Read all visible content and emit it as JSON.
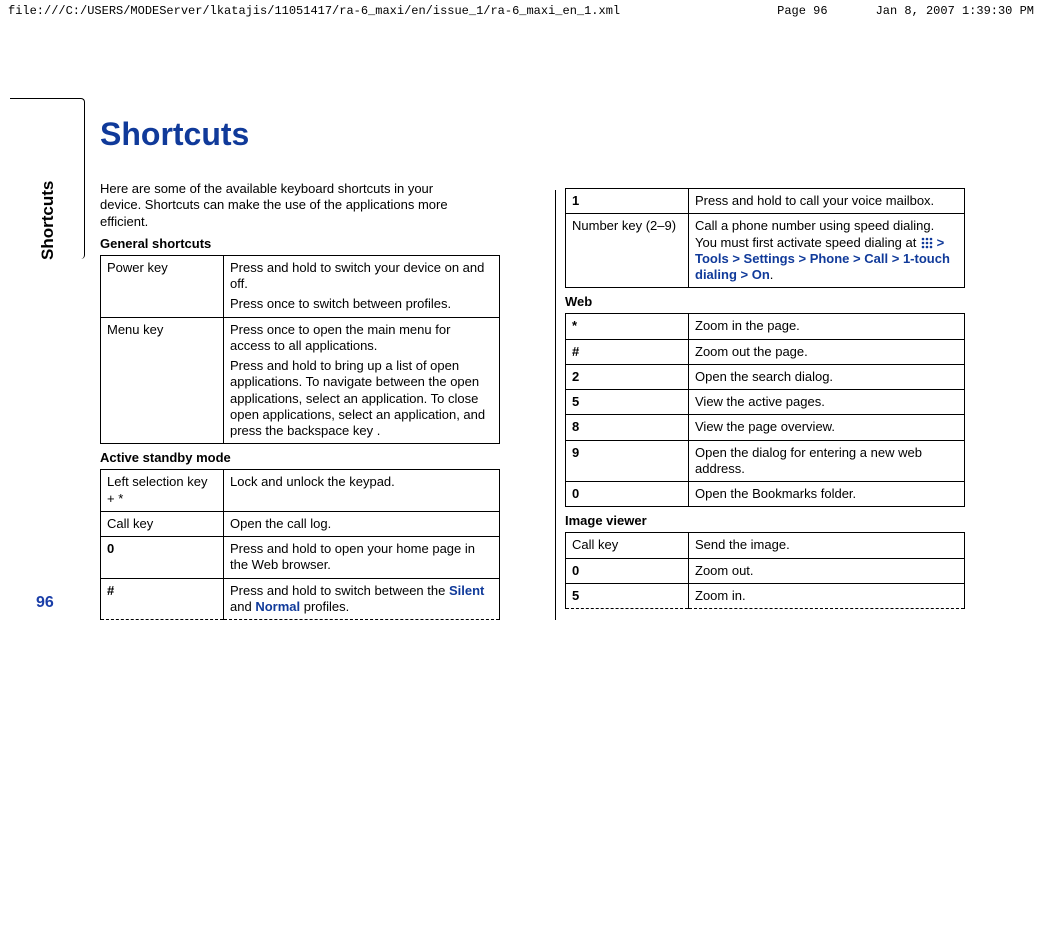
{
  "header": {
    "path": "file:///C:/USERS/MODEServer/lkatajis/11051417/ra-6_maxi/en/issue_1/ra-6_maxi_en_1.xml",
    "pageLabel": "Page 96",
    "date": "Jan 8, 2007 1:39:30 PM"
  },
  "sideTab": "Shortcuts",
  "pageNumber": "96",
  "title": "Shortcuts",
  "intro": "Here are some of the available keyboard shortcuts in your device. Shortcuts can make the use of the applications more efficient.",
  "sections": {
    "general": {
      "label": "General shortcuts",
      "rows": [
        {
          "key": "Power key",
          "desc1": "Press and hold to switch your device on and off.",
          "desc2": "Press once to switch between profiles."
        },
        {
          "key": "Menu key",
          "desc1": "Press once to open the main menu for access to all applications.",
          "desc2": "Press and hold to bring up a list of open applications. To navigate between the open applications, select an application. To close open applications, select an application, and press the backspace key ."
        }
      ]
    },
    "standby": {
      "label": "Active standby mode",
      "rows": [
        {
          "key": "Left selection key + *",
          "desc": "Lock and unlock the keypad."
        },
        {
          "key": "Call key",
          "desc": "Open the call log."
        },
        {
          "key": "0",
          "desc": "Press and hold to open your home page in the Web browser."
        },
        {
          "key": "#",
          "desc_pre": "Press and hold to switch between the ",
          "link1": "Silent",
          "mid": " and ",
          "link2": "Normal",
          "desc_post": " profiles."
        },
        {
          "key": "1",
          "desc": "Press and hold to call your voice mailbox."
        },
        {
          "key": "Number key (2–9)",
          "desc_pre": "Call a phone number using speed dialing. You must first activate speed dialing at ",
          "nav": [
            "Tools",
            "Settings",
            "Phone",
            "Call",
            "1-touch dialing",
            "On"
          ],
          "desc_post": "."
        }
      ]
    },
    "web": {
      "label": "Web",
      "rows": [
        {
          "key": "*",
          "desc": "Zoom in the page."
        },
        {
          "key": "#",
          "desc": "Zoom out the page."
        },
        {
          "key": "2",
          "desc": "Open the search dialog."
        },
        {
          "key": "5",
          "desc": "View the active pages."
        },
        {
          "key": "8",
          "desc": "View the page overview."
        },
        {
          "key": "9",
          "desc": "Open the dialog for entering a new web address."
        },
        {
          "key": "0",
          "desc": "Open the Bookmarks folder."
        }
      ]
    },
    "image": {
      "label": "Image viewer",
      "rows": [
        {
          "key": "Call key",
          "desc": "Send the image."
        },
        {
          "key": "0",
          "desc": "Zoom out."
        },
        {
          "key": "5",
          "desc": "Zoom in."
        }
      ]
    }
  }
}
